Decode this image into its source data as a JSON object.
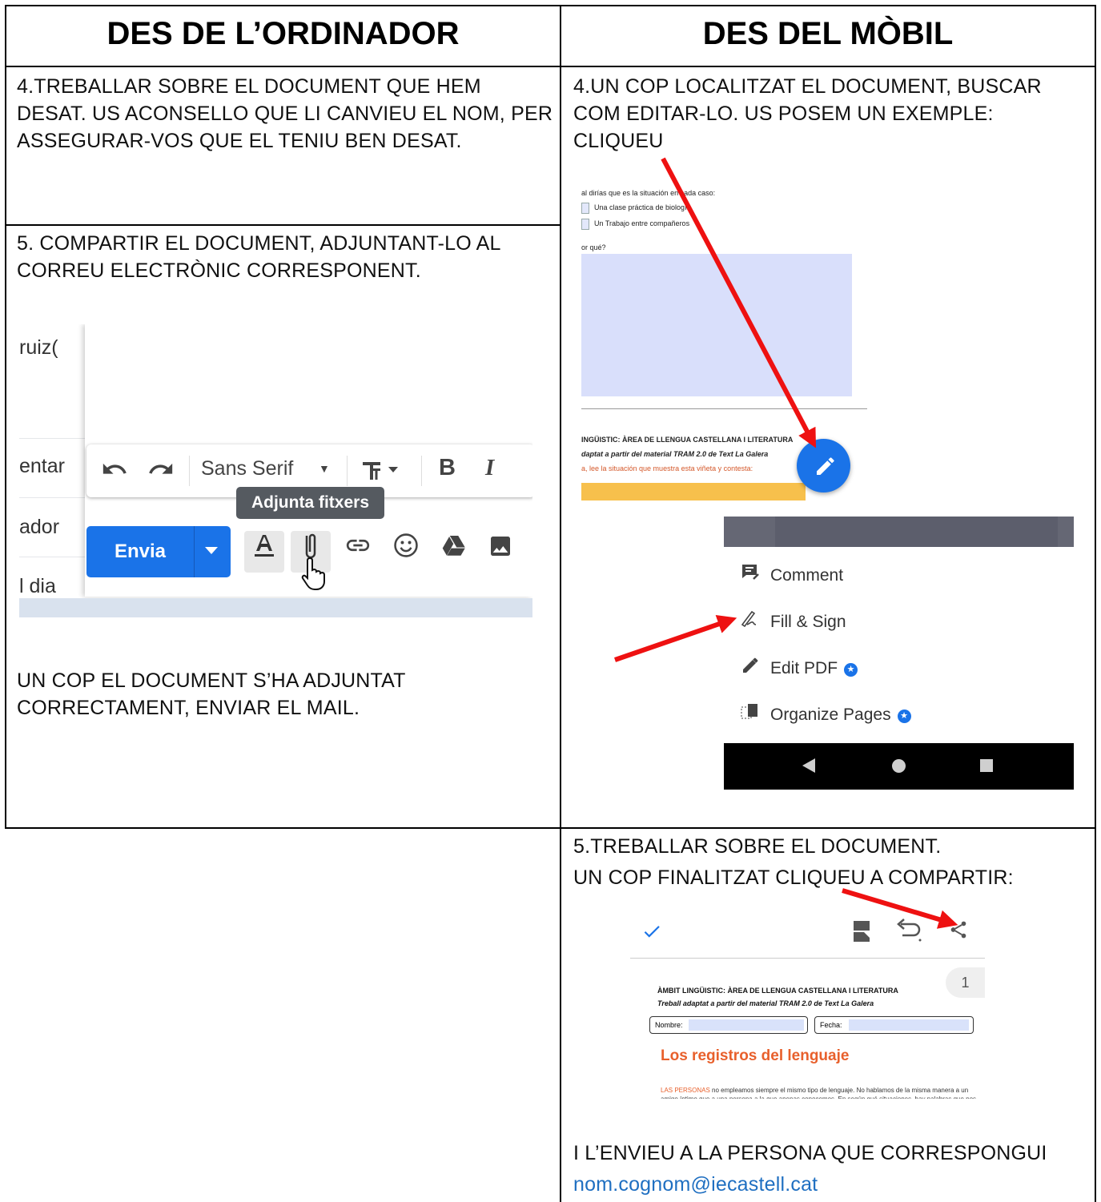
{
  "headers": {
    "left": "DES DE L’ORDINADOR",
    "right": "DES DEL MÒBIL"
  },
  "left": {
    "step4": "4.TREBALLAR SOBRE EL DOCUMENT QUE HEM DESAT. US ACONSELLO QUE LI CANVIEU EL NOM, PER ASSEGURAR-VOS QUE EL TENIU BEN DESAT.",
    "step5": "5. COMPARTIR EL DOCUMENT, ADJUNTANT-LO AL CORREU ELECTRÒNIC CORRESPONENT.",
    "after": "UN COP EL DOCUMENT S’HA ADJUNTAT CORRECTAMENT, ENVIAR EL MAIL."
  },
  "gmail": {
    "fragments": [
      "ruiz(",
      "entar",
      "ador",
      "l dia"
    ],
    "font": "Sans Serif",
    "tooltip": "Adjunta fitxers",
    "send": "Envia"
  },
  "right": {
    "step4": "4.UN COP  LOCALITZAT EL DOCUMENT,  BUSCAR COM EDITAR-LO. US POSEM UN EXEMPLE: CLIQUEU",
    "step5_line1": "5.TREBALLAR SOBRE EL DOCUMENT.",
    "step5_line2": "UN COP FINALITZAT CLIQUEU A COMPARTIR:",
    "send_to": "I L’ENVIEU A LA PERSONA QUE CORRESPONGUI",
    "email": "nom.cognom@iecastell.cat"
  },
  "pdf": {
    "q": "al dirías que es la situación en cada caso:",
    "opt1": "Una clase práctica de biología",
    "opt2": "Un Trabajo entre compañeros",
    "why": "or qué?",
    "heading": "INGÜISTIC: ÀREA DE LLENGUA CASTELLANA I LITERATURA",
    "sub": "daptat a partir del material TRAM 2.0 de Text La Galera",
    "instr": "a, lee la situación que muestra esta viñeta y contesta:"
  },
  "menu": {
    "items": [
      "Comment",
      "Fill & Sign",
      "Edit PDF",
      "Organize Pages"
    ]
  },
  "share": {
    "page": "1",
    "heading": "ÀMBIT LINGÜISTIC: ÀREA DE LLENGUA CASTELLANA I LITERATURA",
    "sub": "Treball adaptat a partir del material TRAM 2.0 de Text La Galera",
    "nombre": "Nombre:",
    "fecha": "Fecha:",
    "title": "Los registros del lenguaje",
    "para_lead": "LAS PERSONAS",
    "para": " no empleamos siempre el mismo tipo de lenguaje. No hablamos de la misma manera a un amigo íntimo que a una persona a la que apenas conocemos. En según qué situaciones, hay palabras que nos suenan mal o que nos produce cierta"
  },
  "colors": {
    "arrow": "#ee1111",
    "accent": "#1a73e8",
    "link": "#1f6fc1"
  }
}
